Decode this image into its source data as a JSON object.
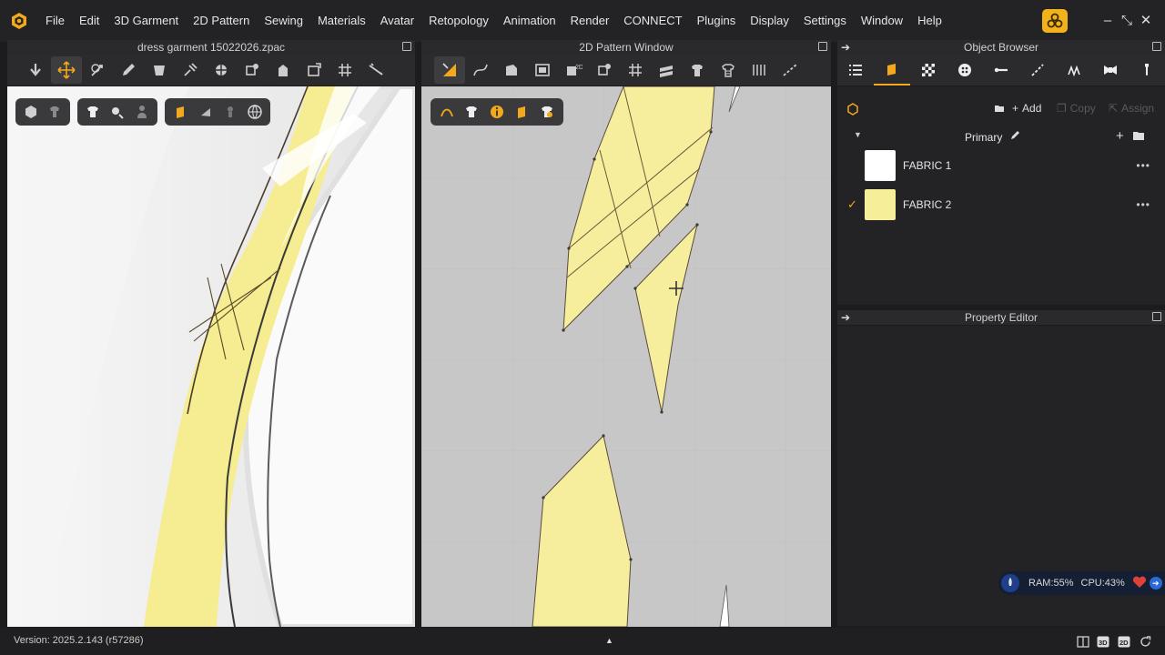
{
  "menu": {
    "items": [
      "File",
      "Edit",
      "3D Garment",
      "2D Pattern",
      "Sewing",
      "Materials",
      "Avatar",
      "Retopology",
      "Animation",
      "Render",
      "CONNECT",
      "Plugins",
      "Display",
      "Settings",
      "Window",
      "Help"
    ]
  },
  "panels": {
    "viewport3d_title": "dress garment 15022026.zpac",
    "pattern2d_title": "2D Pattern Window",
    "object_browser_title": "Object Browser",
    "property_editor_title": "Property Editor"
  },
  "object_browser": {
    "add_label": "Add",
    "copy_label": "Copy",
    "assign_label": "Assign",
    "group_label": "Primary",
    "fabrics": [
      {
        "name": "FABRIC 1",
        "color": "#ffffff",
        "selected": false
      },
      {
        "name": "FABRIC 2",
        "color": "#f7ee9a",
        "selected": true
      }
    ]
  },
  "monitor": {
    "ram": "RAM:55%",
    "cpu": "CPU:43%"
  },
  "status": {
    "version": "Version: 2025.2.143 (r57286)"
  },
  "colors": {
    "accent": "#f2a91b",
    "fabric_yellow": "#f7ee9a",
    "panel_bg": "#232325"
  }
}
